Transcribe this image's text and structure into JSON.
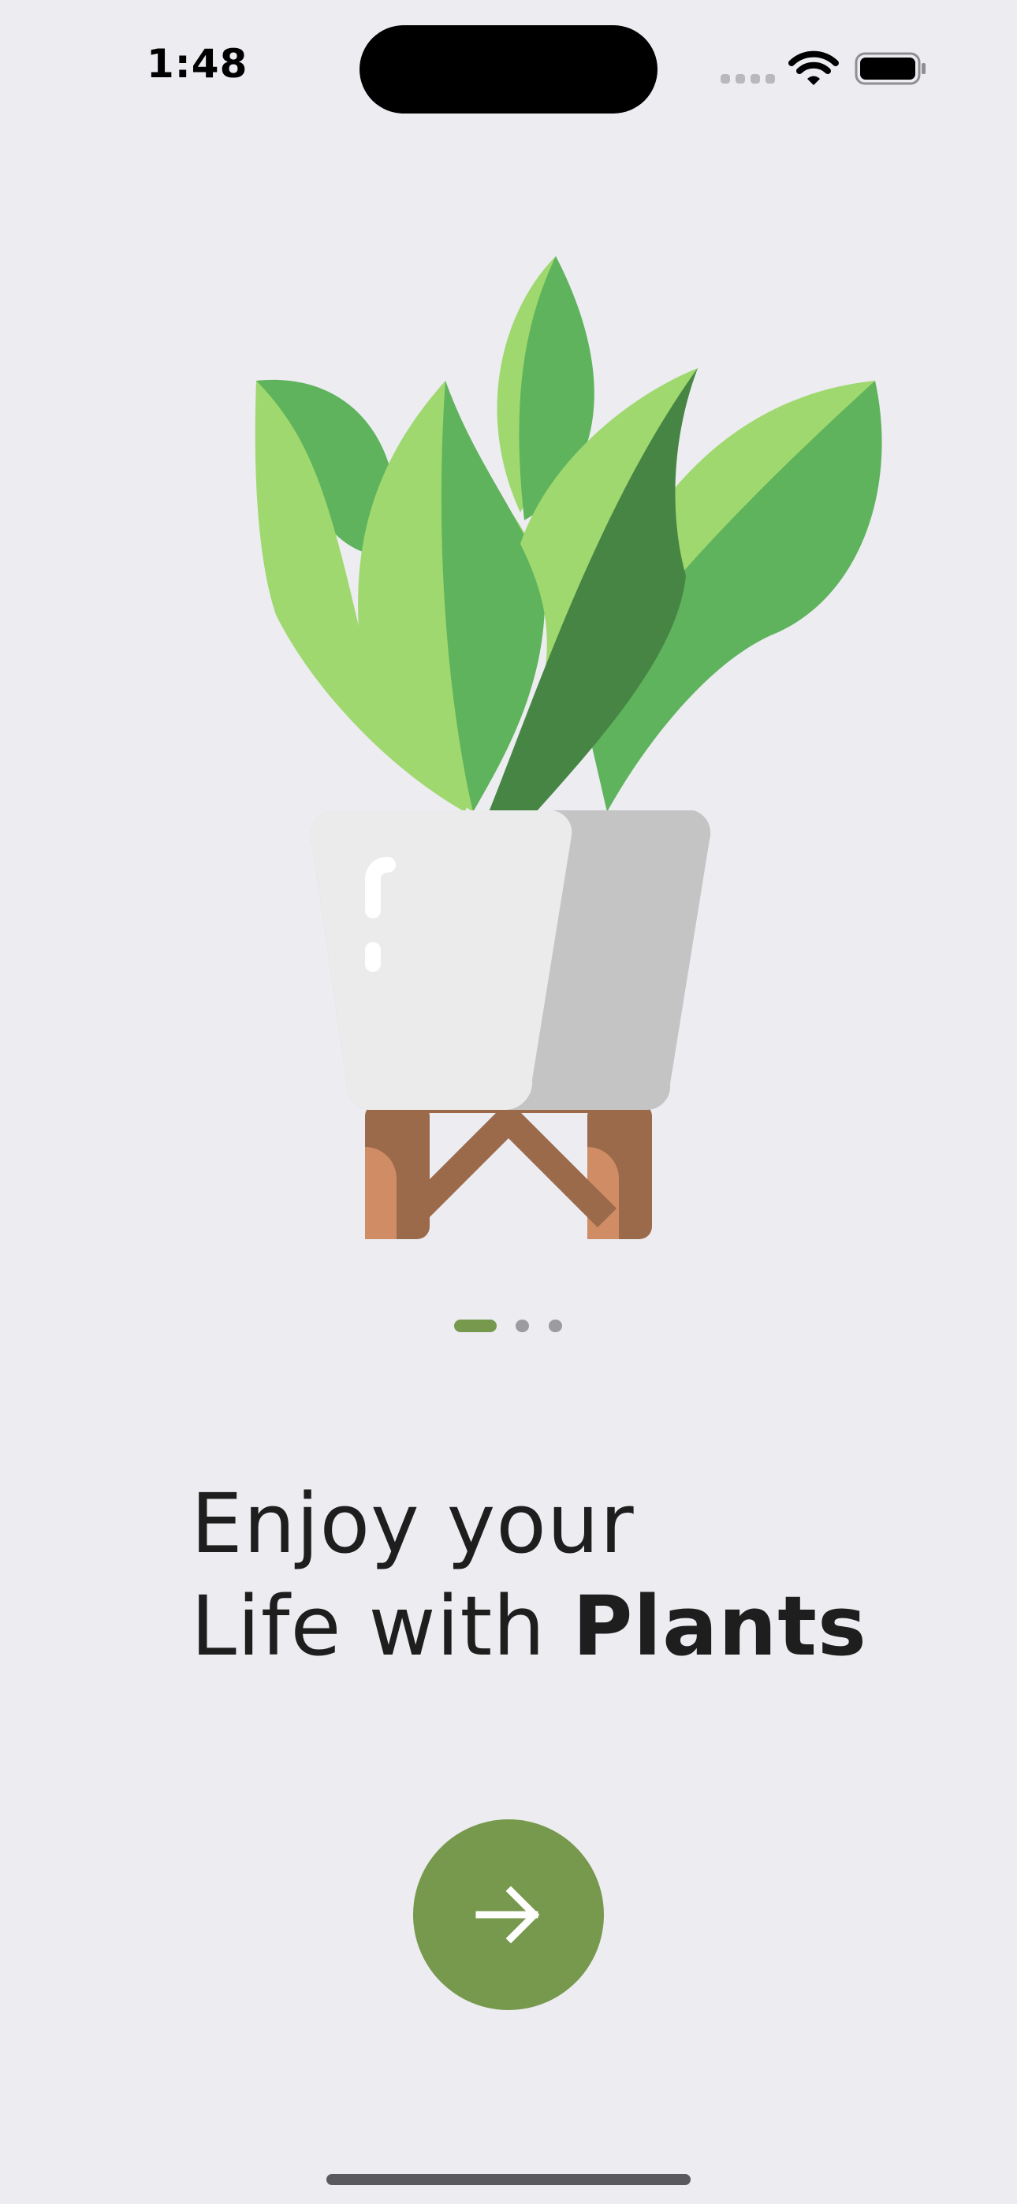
{
  "status_bar": {
    "time": "1:48",
    "signal_icon": "cellular-signal-icon",
    "wifi_icon": "wifi-icon",
    "battery_icon": "battery-icon"
  },
  "illustration": {
    "icon": "potted-plant-icon"
  },
  "pager": {
    "page_count": 3,
    "current_page": 1,
    "active_color": "#76994d",
    "inactive_color": "#9b9ba0"
  },
  "headline": {
    "line1": "Enjoy your",
    "line2_regular": "Life with",
    "line2_bold": "Plants"
  },
  "next_button": {
    "icon": "arrow-right-icon",
    "color": "#76994d"
  }
}
